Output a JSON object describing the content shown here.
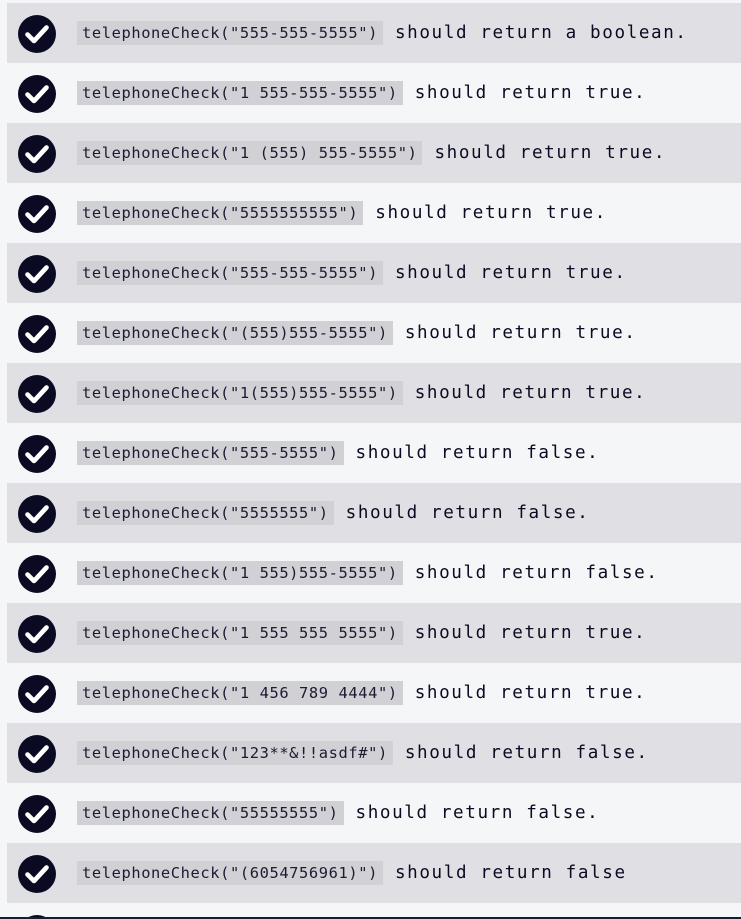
{
  "icon_check": "check-circle-icon",
  "colors": {
    "icon_bg": "#0a0a23",
    "icon_fg": "#ffffff",
    "row_shade": "#e0e0e4",
    "row_plain": "#f5f6f7",
    "code_bg": "#d0d0d5"
  },
  "tests": [
    {
      "code": "telephoneCheck(\"555-555-5555\")",
      "text": "should return a boolean.",
      "passed": true
    },
    {
      "code": "telephoneCheck(\"1 555-555-5555\")",
      "text": "should return true.",
      "passed": true
    },
    {
      "code": "telephoneCheck(\"1 (555) 555-5555\")",
      "text": "should return true.",
      "passed": true
    },
    {
      "code": "telephoneCheck(\"5555555555\")",
      "text": "should return true.",
      "passed": true
    },
    {
      "code": "telephoneCheck(\"555-555-5555\")",
      "text": "should return true.",
      "passed": true
    },
    {
      "code": "telephoneCheck(\"(555)555-5555\")",
      "text": "should return true.",
      "passed": true
    },
    {
      "code": "telephoneCheck(\"1(555)555-5555\")",
      "text": "should return true.",
      "passed": true
    },
    {
      "code": "telephoneCheck(\"555-5555\")",
      "text": "should return false.",
      "passed": true
    },
    {
      "code": "telephoneCheck(\"5555555\")",
      "text": "should return false.",
      "passed": true
    },
    {
      "code": "telephoneCheck(\"1 555)555-5555\")",
      "text": "should return false.",
      "passed": true
    },
    {
      "code": "telephoneCheck(\"1 555 555 5555\")",
      "text": "should return true.",
      "passed": true
    },
    {
      "code": "telephoneCheck(\"1 456 789 4444\")",
      "text": "should return true.",
      "passed": true
    },
    {
      "code": "telephoneCheck(\"123**&!!asdf#\")",
      "text": "should return false.",
      "passed": true
    },
    {
      "code": "telephoneCheck(\"55555555\")",
      "text": "should return false.",
      "passed": true
    },
    {
      "code": "telephoneCheck(\"(6054756961)\")",
      "text": "should return false",
      "passed": true
    }
  ]
}
